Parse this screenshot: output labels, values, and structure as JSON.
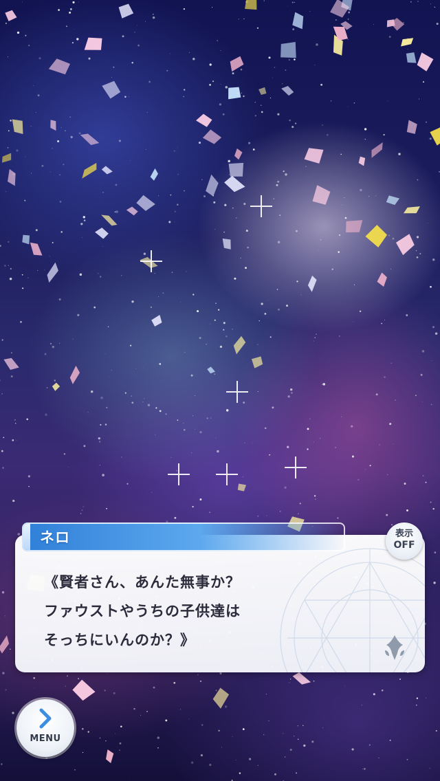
{
  "dialog": {
    "speaker": "ネロ",
    "text": "《賢者さん、あんた無事か？\nファウストやうちの子供達は\nそっちにいんのか？》"
  },
  "display_toggle": {
    "line1": "表示",
    "line2": "OFF"
  },
  "menu": {
    "label": "MENU"
  },
  "colors": {
    "name_plate": "#2f7fd8",
    "dialog_text": "#2b2b3b",
    "chevron": "#3d8ee0"
  },
  "icons": {
    "menu": "chevron-right-icon",
    "crest": "crest-emblem-icon"
  }
}
